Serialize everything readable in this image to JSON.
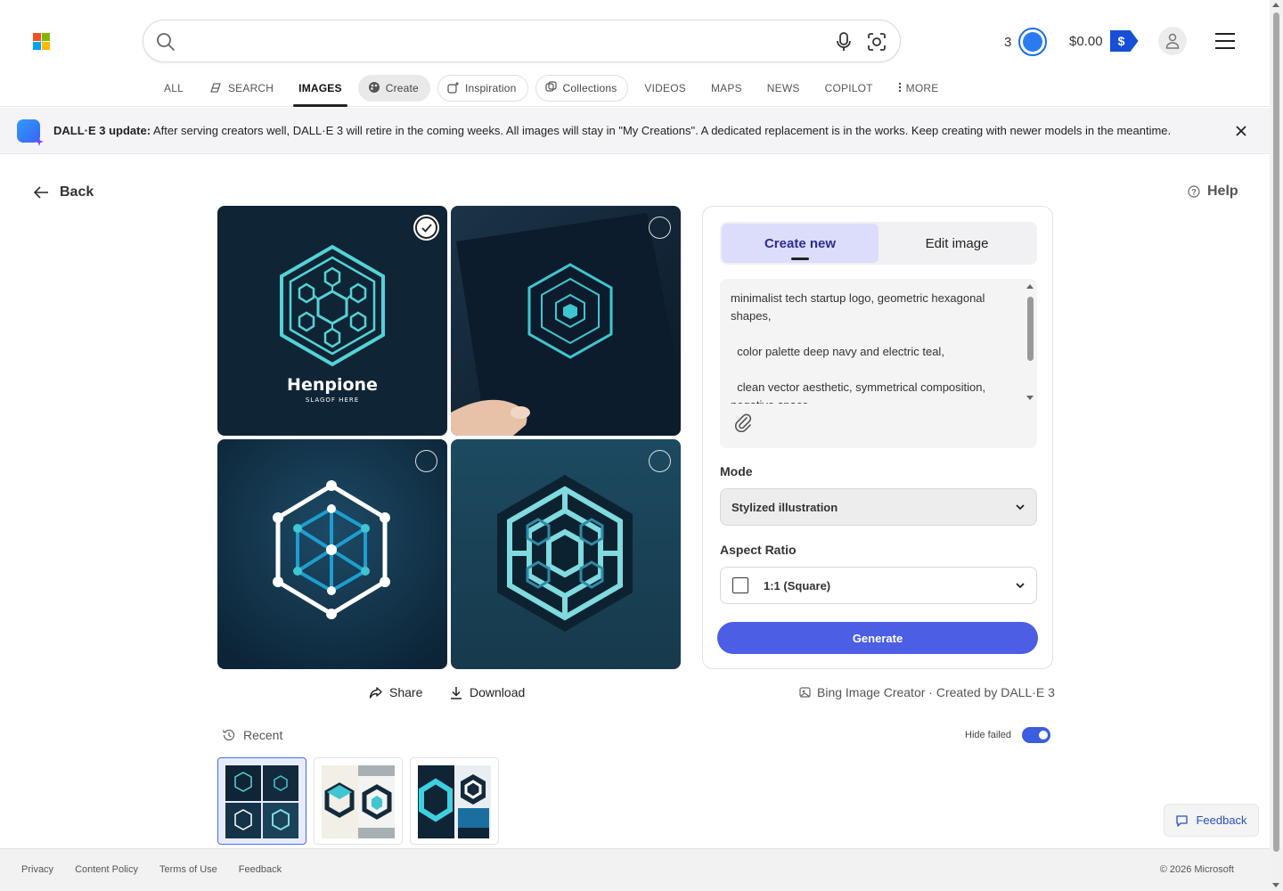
{
  "header": {
    "search_value": "",
    "rewards_count": "3",
    "wallet_amount": "$0.00",
    "wallet_symbol": "$"
  },
  "nav": {
    "tabs": [
      {
        "label": "ALL"
      },
      {
        "label": "SEARCH",
        "icon": "copilot-search-icon"
      },
      {
        "label": "IMAGES",
        "active": true
      },
      {
        "label": "Create",
        "icon": "palette-icon"
      },
      {
        "label": "Inspiration",
        "icon": "sparkle-image-icon"
      },
      {
        "label": "Collections",
        "icon": "collections-icon"
      },
      {
        "label": "VIDEOS"
      },
      {
        "label": "MAPS"
      },
      {
        "label": "NEWS"
      },
      {
        "label": "COPILOT"
      },
      {
        "label": "MORE",
        "icon": "kebab-icon"
      }
    ]
  },
  "banner": {
    "title": "DALL·E 3 update:",
    "message": "After serving creators well, DALL·E 3 will retire in the coming weeks. All images will stay in \"My Creations\". A dedicated replacement is in the works. Keep creating with newer models in the meantime."
  },
  "page": {
    "back_label": "Back",
    "help_label": "Help"
  },
  "images": [
    {
      "name": "Henpione logo",
      "caption_title": "Henpione",
      "caption_sub": "SLAGOF HERE",
      "selected": true
    },
    {
      "name": "hexagon card mockup",
      "selected": false
    },
    {
      "name": "node hexagon",
      "selected": false
    },
    {
      "name": "maze hexagon",
      "selected": false
    }
  ],
  "panel": {
    "tab_create": "Create new",
    "tab_edit": "Edit image",
    "prompt": "minimalist tech startup logo, geometric hexagonal shapes,\n\n  color palette deep navy and electric teal,\n\n  clean vector aesthetic, symmetrical composition,\nnegative space",
    "mode_label": "Mode",
    "mode_value": "Stylized illustration",
    "aspect_label": "Aspect Ratio",
    "aspect_value": "1:1 (Square)",
    "generate_label": "Generate"
  },
  "actions": {
    "share": "Share",
    "download": "Download",
    "credit": "Bing Image Creator · Created by DALL·E 3"
  },
  "recent": {
    "label": "Recent",
    "hide_failed_label": "Hide failed",
    "hide_failed_on": true,
    "thumbs": 3
  },
  "feedback_label": "Feedback",
  "footer": {
    "links": [
      "Privacy",
      "Content Policy",
      "Terms of Use",
      "Feedback"
    ],
    "copyright": "© 2026 Microsoft"
  },
  "colors": {
    "navy": "#0e2638",
    "teal": "#3fc6d0",
    "accent": "#4b5ee4",
    "ms_red": "#f25022",
    "ms_green": "#7fba00",
    "ms_blue": "#00a4ef",
    "ms_yellow": "#ffb900"
  }
}
